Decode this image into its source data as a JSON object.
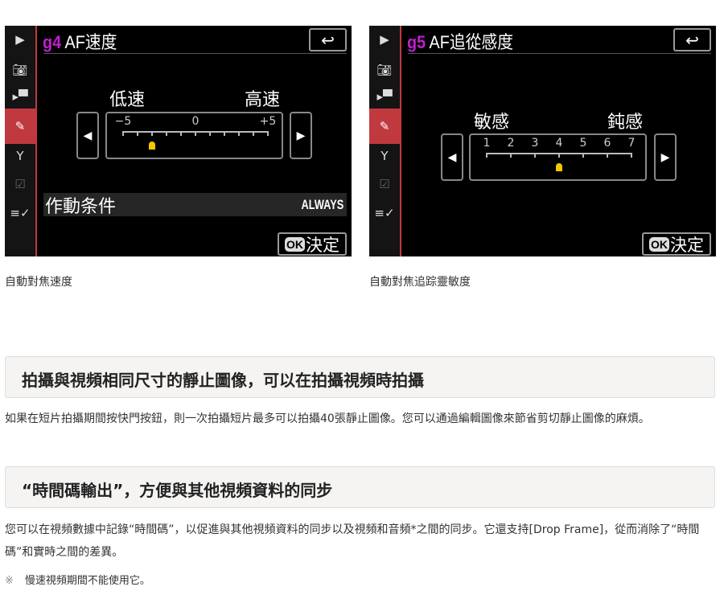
{
  "screens": [
    {
      "code": "g4",
      "title": "AF速度",
      "left_label": "低速",
      "right_label": "高速",
      "scale_labels": [
        "−5",
        "0",
        "+5"
      ],
      "tick_count": 11,
      "selected_index": 2,
      "row_label": "作動条件",
      "row_value": "ALWAYS",
      "back_icon": "↩",
      "ok_badge": "OK",
      "ok_label": "決定",
      "caption": "自動對焦速度"
    },
    {
      "code": "g5",
      "title": "AF追從感度",
      "left_label": "敏感",
      "right_label": "鈍感",
      "scale_labels": [
        "1",
        "2",
        "3",
        "4",
        "5",
        "6",
        "7"
      ],
      "tick_count": 7,
      "selected_index": 3,
      "back_icon": "↩",
      "ok_badge": "OK",
      "ok_label": "決定",
      "caption": "自動對焦追踪靈敏度"
    }
  ],
  "colors": {
    "accent": "#c0393f",
    "code": "#c01fd0",
    "marker": "#f5c800"
  },
  "sections": [
    {
      "heading": "拍攝與視頻相同尺寸的靜止圖像，可以在拍攝視頻時拍攝",
      "body": "如果在短片拍攝期間按快門按鈕，則一次拍攝短片最多可以拍攝40張靜止圖像。您可以通過編輯圖像來節省剪切靜止圖像的麻煩。"
    },
    {
      "heading": "“時間碼輸出”，方便與其他視頻資料的同步",
      "body": "您可以在視頻數據中記錄“時間碼”，以促進與其他視頻資料的同步以及視頻和音頻*之間的同步。它還支持[Drop Frame]，從而消除了“時間碼”和實時之間的差異。"
    }
  ],
  "note": {
    "mark": "※",
    "text": "慢速視頻期間不能使用它。"
  }
}
